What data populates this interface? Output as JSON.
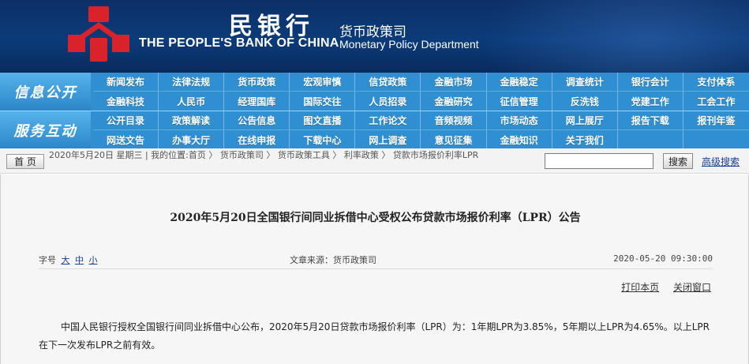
{
  "header": {
    "brand_cn": "民银行",
    "brand_en": "THE PEOPLE'S BANK OF CHINA",
    "dept_cn": "货币政策司",
    "dept_en": "Monetary Policy Department",
    "logo_color": "#d9222a"
  },
  "nav": {
    "section1_title": "信息公开",
    "section1_items": [
      "新闻发布",
      "法律法规",
      "货币政策",
      "宏观审慎",
      "信贷政策",
      "金融市场",
      "金融稳定",
      "调查统计",
      "银行会计",
      "支付体系",
      "金融科技",
      "人民币",
      "经理国库",
      "国际交往",
      "人员招录",
      "金融研究",
      "征信管理",
      "反洗钱",
      "党建工作",
      "工会工作"
    ],
    "section2_title": "服务互动",
    "section2_items": [
      "公开目录",
      "政策解读",
      "公告信息",
      "图文直播",
      "工作论文",
      "音频视频",
      "市场动态",
      "网上展厅",
      "报告下载",
      "报刊年鉴",
      "网送文告",
      "办事大厅",
      "在线申报",
      "下载中心",
      "网上调查",
      "意见征集",
      "金融知识",
      "关于我们",
      "",
      ""
    ]
  },
  "crumbbar": {
    "home_label": "首 页",
    "crumb_text": "2020年5月20日 星期三 | 我的位置:首页 〉 货币政策司 〉 货币政策工具 〉 利率政策 〉 贷款市场报价利率LPR",
    "search_value": "",
    "search_button": "搜索",
    "advanced_search": "高级搜索"
  },
  "article": {
    "title": "2020年5月20日全国银行间同业拆借中心受权公布贷款市场报价利率（LPR）公告",
    "font_size_label": "字号",
    "font_large": "大",
    "font_medium": "中",
    "font_small": "小",
    "source": "文章来源：货币政策司",
    "date": "2020-05-20 09:30:00",
    "print_label": "打印本页",
    "close_label": "关闭窗口",
    "body": "中国人民银行授权全国银行间同业拆借中心公布，2020年5月20日贷款市场报价利率（LPR）为：1年期LPR为3.85%，5年期以上LPR为4.65%。以上LPR在下一次发布LPR之前有效。"
  }
}
